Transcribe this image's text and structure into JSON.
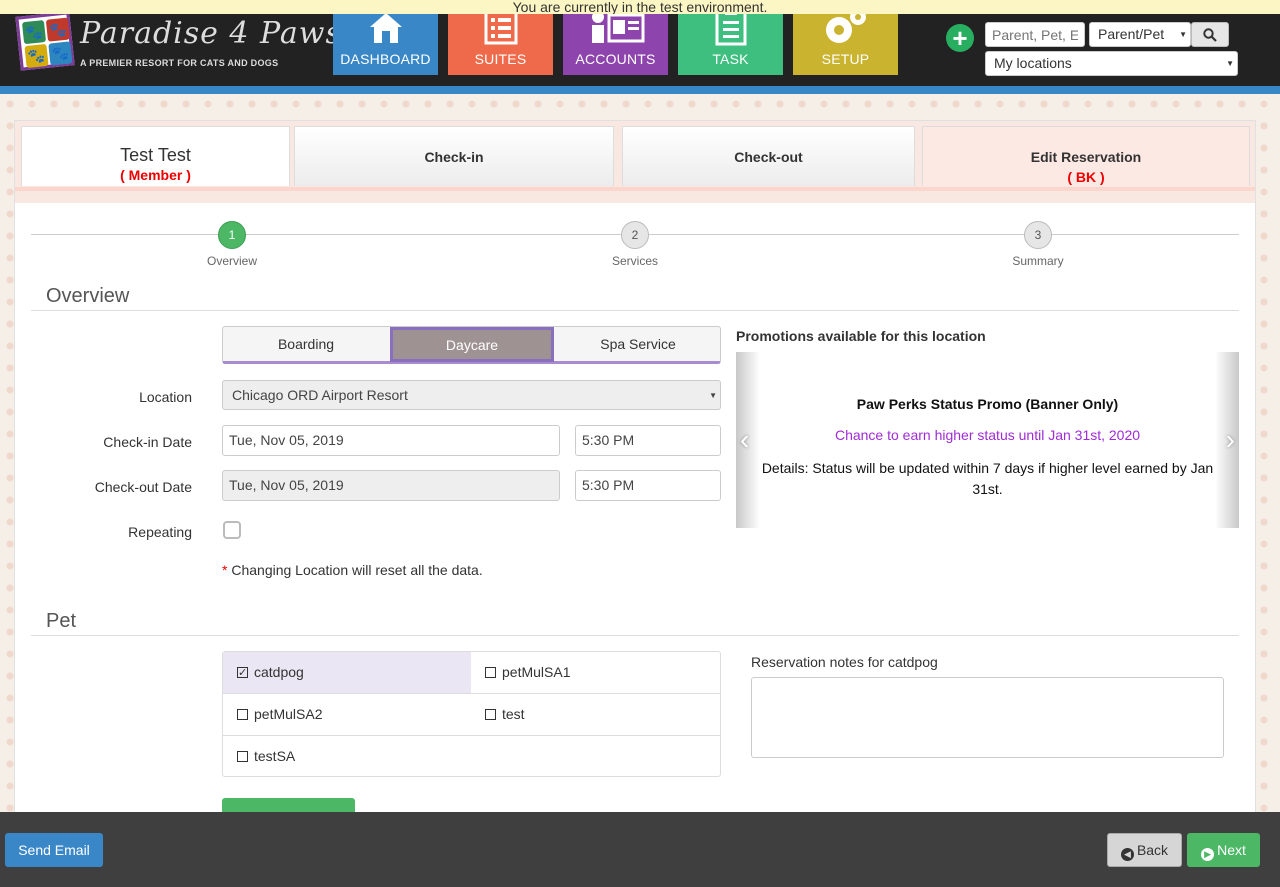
{
  "banner": {
    "test_env": "You are currently in the test environment."
  },
  "logo": {
    "brand": "Paradise 4 Paws",
    "tagline": "A PREMIER RESORT FOR CATS AND DOGS"
  },
  "nav": [
    {
      "label": "DASHBOARD",
      "color": "#3a87c8",
      "icon": "house-icon"
    },
    {
      "label": "SUITES",
      "color": "#ee6a4a",
      "icon": "list-icon"
    },
    {
      "label": "ACCOUNTS",
      "color": "#8e44ad",
      "icon": "id-card-icon"
    },
    {
      "label": "TASK",
      "color": "#3fbf7f",
      "icon": "clipboard-icon"
    },
    {
      "label": "SETUP",
      "color": "#c9b32f",
      "icon": "gears-icon"
    }
  ],
  "search": {
    "placeholder": "Parent, Pet, E",
    "type_selected": "Parent/Pet",
    "locations_selected": "My locations"
  },
  "tabs": {
    "member_name": "Test Test",
    "member_status": "( Member )",
    "checkin": "Check-in",
    "checkout": "Check-out",
    "edit": "Edit Reservation",
    "edit_sub": "( BK )"
  },
  "steps": [
    {
      "num": "1",
      "label": "Overview"
    },
    {
      "num": "2",
      "label": "Services"
    },
    {
      "num": "3",
      "label": "Summary"
    }
  ],
  "overview": {
    "title": "Overview",
    "service_types": [
      "Boarding",
      "Daycare",
      "Spa Service"
    ],
    "location_label": "Location",
    "location_value": "Chicago ORD Airport Resort",
    "checkin_label": "Check-in Date",
    "checkin_date": "Tue, Nov 05, 2019",
    "checkin_time": "5:30 PM",
    "checkout_label": "Check-out Date",
    "checkout_date": "Tue, Nov 05, 2019",
    "checkout_time": "5:30 PM",
    "repeating_label": "Repeating",
    "note_star": "*",
    "note_text": "Changing Location will reset all the data."
  },
  "promo": {
    "heading": "Promotions available for this location",
    "title": "Paw Perks Status Promo (Banner Only)",
    "subtitle": "Chance to earn higher status until Jan 31st, 2020",
    "details": "Details: Status will be updated within 7 days if higher level earned by Jan 31st."
  },
  "pet": {
    "title": "Pet",
    "pets": [
      {
        "name": "catdpog",
        "checked": true
      },
      {
        "name": "petMulSA1",
        "checked": false
      },
      {
        "name": "petMulSA2",
        "checked": false
      },
      {
        "name": "test",
        "checked": false
      },
      {
        "name": "testSA",
        "checked": false
      }
    ],
    "notes_label": "Reservation notes for catdpog"
  },
  "footer": {
    "send_email": "Send Email",
    "back": "Back",
    "next": "Next"
  }
}
